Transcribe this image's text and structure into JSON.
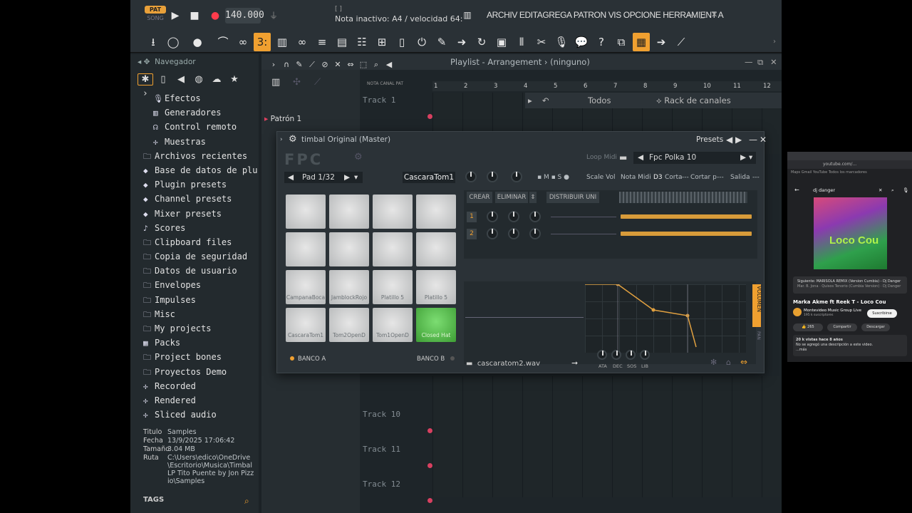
{
  "transport": {
    "pat_label": "PAT",
    "song_label": "SONG",
    "tempo": "140.000",
    "hint_ticks": "[ ]",
    "hint": "Nota inactivo: A4 / velocidad 64:",
    "menu": "ARCHIV EDITAGREGA PATRON  VIS OPCIONE HERRAMIENT A",
    "colors": {
      "accent": "#f0a030",
      "record": "#ff3c4c"
    }
  },
  "browser": {
    "title": "Navegador",
    "items": [
      {
        "label": "Efectos",
        "icon": "effects-icon",
        "glyph": "🎙",
        "sub": true
      },
      {
        "label": "Generadores",
        "icon": "piano-icon",
        "glyph": "▥",
        "sub": true
      },
      {
        "label": "Control remoto",
        "icon": "remote-icon",
        "glyph": "☊",
        "sub": true
      },
      {
        "label": "Muestras",
        "icon": "wave-icon",
        "glyph": "✢",
        "sub": true
      },
      {
        "label": "Archivos recientes",
        "icon": "folder-icon",
        "glyph": "🗀",
        "sub": false
      },
      {
        "label": "Base de datos de plugins",
        "icon": "plug-icon",
        "glyph": "◆",
        "sub": false
      },
      {
        "label": "Plugin presets",
        "icon": "plug-icon",
        "glyph": "◆",
        "sub": false
      },
      {
        "label": "Channel presets",
        "icon": "plug-icon",
        "glyph": "◆",
        "sub": false
      },
      {
        "label": "Mixer presets",
        "icon": "plug-icon",
        "glyph": "◆",
        "sub": false
      },
      {
        "label": "Scores",
        "icon": "note-icon",
        "glyph": "♪",
        "sub": false
      },
      {
        "label": "Clipboard files",
        "icon": "folder-icon",
        "glyph": "🗀",
        "sub": false
      },
      {
        "label": "Copia de seguridad",
        "icon": "folder-icon",
        "glyph": "🗀",
        "sub": false
      },
      {
        "label": "Datos de usuario",
        "icon": "folder-icon",
        "glyph": "🗀",
        "sub": false
      },
      {
        "label": "Envelopes",
        "icon": "folder-icon",
        "glyph": "🗀",
        "sub": false
      },
      {
        "label": "Impulses",
        "icon": "folder-icon",
        "glyph": "🗀",
        "sub": false
      },
      {
        "label": "Misc",
        "icon": "folder-icon",
        "glyph": "🗀",
        "sub": false
      },
      {
        "label": "My projects",
        "icon": "folder-icon",
        "glyph": "🗀",
        "sub": false
      },
      {
        "label": "Packs",
        "icon": "packs-icon",
        "glyph": "▦",
        "sub": false
      },
      {
        "label": "Project bones",
        "icon": "folder-icon",
        "glyph": "🗀",
        "sub": false
      },
      {
        "label": "Proyectos Demo",
        "icon": "folder-icon",
        "glyph": "🗀",
        "sub": false
      },
      {
        "label": "Recorded",
        "icon": "wave-icon",
        "glyph": "✢",
        "sub": false
      },
      {
        "label": "Rendered",
        "icon": "wave-icon",
        "glyph": "✢",
        "sub": false
      },
      {
        "label": "Sliced audio",
        "icon": "wave-icon",
        "glyph": "✢",
        "sub": false
      }
    ],
    "info": [
      {
        "k": "Titulo",
        "v": "Samples"
      },
      {
        "k": "Fecha",
        "v": "13/9/2025 17:06:42"
      },
      {
        "k": "Tamaño",
        "v": "3.04 MB"
      },
      {
        "k": "Ruta",
        "v": "C:\\Users\\edico\\OneDrive\\Escritorio\\Musica\\Timbal LP Tito Puente by Jon Pizzio\\Samples"
      }
    ],
    "tags_label": "TAGS"
  },
  "playlist": {
    "title": "Playlist - Arrangement › (ninguno)",
    "pattern": "Patrón 1",
    "mini_labels": "NOTA CANAL PAT",
    "ruler": [
      "1",
      "2",
      "3",
      "4",
      "5",
      "6",
      "7",
      "8",
      "9",
      "10",
      "11",
      "12"
    ],
    "tracks": [
      {
        "label": "Track 1",
        "row": 0
      },
      {
        "label": "Track 10",
        "row": 9
      },
      {
        "label": "Track 11",
        "row": 10
      },
      {
        "label": "Track 12",
        "row": 11
      }
    ],
    "rack_filter": "Todos",
    "rack_title": "Rack de canales"
  },
  "fpc": {
    "title": "timbal Original (Master)",
    "presets_label": "Presets",
    "logo": "FPC",
    "loop_midi": "Loop Midi",
    "preset_name": "Fpc Polka 10",
    "pad_selector": "Pad 1/32",
    "pad_name": "CascaraTom1",
    "scale_vol": "Scale Vol",
    "nota_midi": "Nota Midi",
    "nota_value": "D3",
    "corta": "Corta",
    "cortar_p": "Cortar p",
    "salida": "Salida",
    "btn_crear": "CREAR",
    "btn_eliminar": "ELIMINAR",
    "btn_distribuir": "DISTRIBUIR UNI",
    "pads": [
      "",
      "",
      "",
      "",
      "",
      "",
      "",
      "",
      "CampanaBoca",
      "JamblockRojo",
      "Platillo 5",
      "Platillo 5",
      "CascaraTom1",
      "Tom2OpenD",
      "Tom1OpenD",
      "Closed Hat"
    ],
    "active_pad": 15,
    "bank_a": "BANCO A",
    "bank_b": "BANCO B",
    "layers": [
      "1",
      "2"
    ],
    "volume_tab": "VOLUMEN",
    "pan_tab": "PAN",
    "sample": "cascaratom2.wav",
    "env_labels": [
      "ATA",
      "DEC",
      "SOS",
      "LIB"
    ]
  },
  "youtube": {
    "url": "youtube.com/...",
    "bookmarks": "Maps   Gmail   YouTube                 Todos los marcadores",
    "search": "dj danger",
    "thumb_text": "Loco Cou",
    "next": "Siguiente: MARISOLA REMIX (Version Cumbia) - Dj Danger",
    "next_sub": "Mar. B. Jona · Quisos Tenorio (Cumbia Version) · Dj Danger",
    "title": "Marka Akme ft Reek T - Loco Cou",
    "channel": "Montevideo Music Group Live",
    "subs": "195 k suscriptores",
    "subscribe": "Suscribirse",
    "likes": "265",
    "share": "Compartir",
    "download": "Descargar",
    "views": "20 k vistas  hace 8 años",
    "desc": "No se agregó una descripción a este video.",
    "more": "...más"
  }
}
